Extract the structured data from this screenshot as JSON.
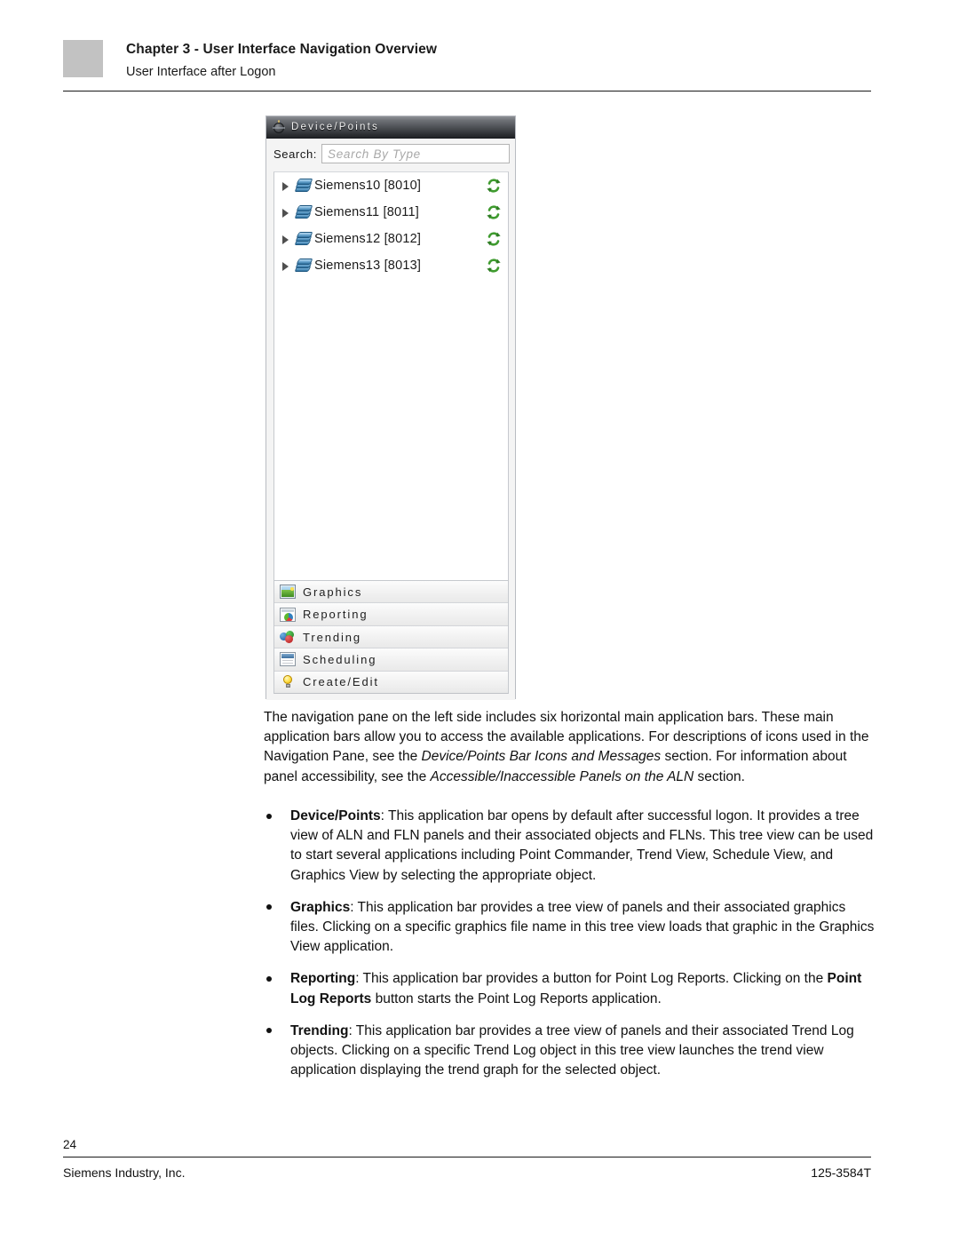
{
  "header": {
    "chapter": "Chapter 3 - User Interface Navigation Overview",
    "subtitle": "User Interface after Logon"
  },
  "screenshot_panel": {
    "titlebar": {
      "icon": "device-points-icon",
      "title": "Device/Points"
    },
    "search": {
      "label": "Search:",
      "value": "",
      "placeholder": "Search By Type"
    },
    "tree": {
      "items": [
        {
          "label": "Siemens10 [8010]",
          "expander": "collapsed-arrow-icon",
          "node_icon": "device-stack-icon",
          "status_icon": "sync-refresh-icon"
        },
        {
          "label": "Siemens11 [8011]",
          "expander": "collapsed-arrow-icon",
          "node_icon": "device-stack-icon",
          "status_icon": "sync-refresh-icon"
        },
        {
          "label": "Siemens12 [8012]",
          "expander": "collapsed-arrow-icon",
          "node_icon": "device-stack-icon",
          "status_icon": "sync-refresh-icon"
        },
        {
          "label": "Siemens13 [8013]",
          "expander": "collapsed-arrow-icon",
          "node_icon": "device-stack-icon",
          "status_icon": "sync-refresh-icon"
        }
      ]
    },
    "application_bars": [
      {
        "label": "Graphics",
        "icon": "picture-icon"
      },
      {
        "label": "Reporting",
        "icon": "report-pie-chart-icon"
      },
      {
        "label": "Trending",
        "icon": "trending-circles-icon"
      },
      {
        "label": "Scheduling",
        "icon": "calendar-window-icon"
      },
      {
        "label": "Create/Edit",
        "icon": "lightbulb-icon"
      }
    ]
  },
  "prose": {
    "p1_a": "The navigation pane on the left side includes six horizontal main application bars. These main application bars allow you to access the available applications. For descriptions of icons used in the Navigation Pane, see the ",
    "p1_i1": "Device/Points Bar Icons and Messages",
    "p1_b": " section. For information about panel accessibility, see the ",
    "p1_i2": "Accessible/Inaccessible Panels on the ALN",
    "p1_c": " section."
  },
  "bullets": [
    {
      "term": "Device/Points",
      "text": ": This application bar opens by default after successful logon. It provides a tree view of ALN and FLN panels and their associated objects and FLNs. This tree view can be used to start several applications including Point Commander, Trend View, Schedule View, and Graphics View by selecting the appropriate object."
    },
    {
      "term": "Graphics",
      "text": ": This application bar provides a tree view of panels and their associated graphics files. Clicking on a specific graphics file name in this tree view loads that graphic in the Graphics View application."
    },
    {
      "term": "Reporting",
      "text_a": ": This application bar provides a button for Point Log Reports. Clicking on the ",
      "term2": "Point Log Reports",
      "text_b": " button starts the Point Log Reports application."
    },
    {
      "term": "Trending",
      "text": ": This application bar provides a tree view of panels and their associated Trend Log objects. Clicking on a specific Trend Log object in this tree view launches the trend view application displaying the trend graph for the selected object."
    }
  ],
  "footer": {
    "page_number": "24",
    "company": "Siemens Industry, Inc.",
    "doc_number": "125-3584T"
  }
}
